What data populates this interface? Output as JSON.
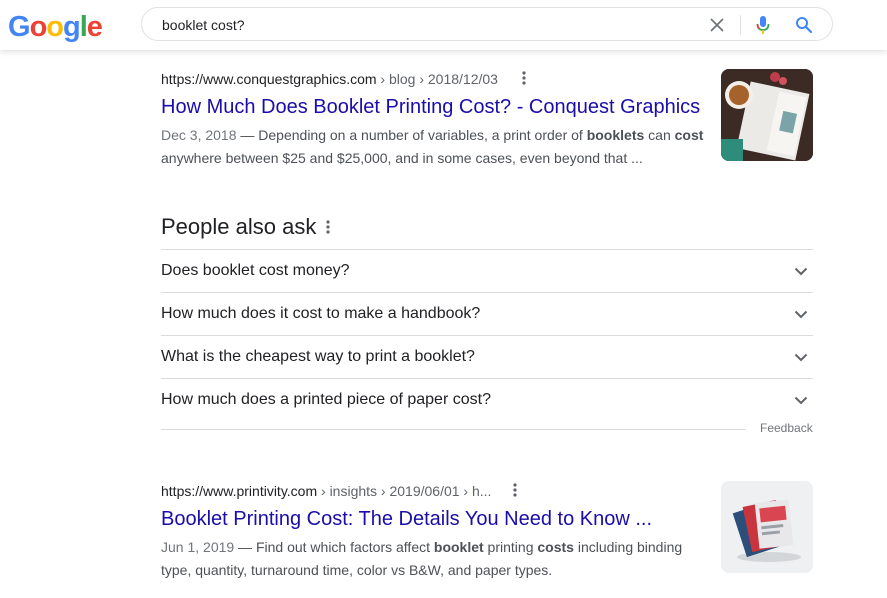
{
  "logo": {
    "letters": [
      "G",
      "o",
      "o",
      "g",
      "l",
      "e"
    ],
    "colors": [
      "#4285f4",
      "#ea4335",
      "#fbbc05",
      "#4285f4",
      "#34a853",
      "#ea4335"
    ]
  },
  "search": {
    "query": "booklet cost?"
  },
  "results": [
    {
      "url": "https://www.conquestgraphics.com",
      "breadcrumb": " › blog › 2018/12/03",
      "title": "How Much Does Booklet Printing Cost? - Conquest Graphics",
      "date": "Dec 3, 2018",
      "snippet_line1_a": " — Depending on a number of variables, a print order of ",
      "snippet_line1_b": "booklets",
      "snippet_line1_c": " can ",
      "snippet_line1_d": "cost",
      "snippet_line2": "anywhere between $25 and $25,000, and in some cases, even beyond that ..."
    },
    {
      "url": "https://www.printivity.com",
      "breadcrumb": " › insights › 2019/06/01 › h...",
      "title": "Booklet Printing Cost: The Details You Need to Know ...",
      "date": "Jun 1, 2019",
      "snippet_line1_a": " — Find out which factors affect ",
      "snippet_line1_b": "booklet",
      "snippet_line1_c": " printing ",
      "snippet_line1_d": "costs",
      "snippet_line1_e": " including binding",
      "snippet_line2": "type, quantity, turnaround time, color vs B&W, and paper types."
    }
  ],
  "paa": {
    "title": "People also ask",
    "questions": [
      "Does booklet cost money?",
      "How much does it cost to make a handbook?",
      "What is the cheapest way to print a booklet?",
      "How much does a printed piece of paper cost?"
    ],
    "feedback": "Feedback"
  },
  "colors": {
    "link": "#1a0dab",
    "mic_blue": "#4285f4",
    "mic_red": "#ea4335"
  }
}
